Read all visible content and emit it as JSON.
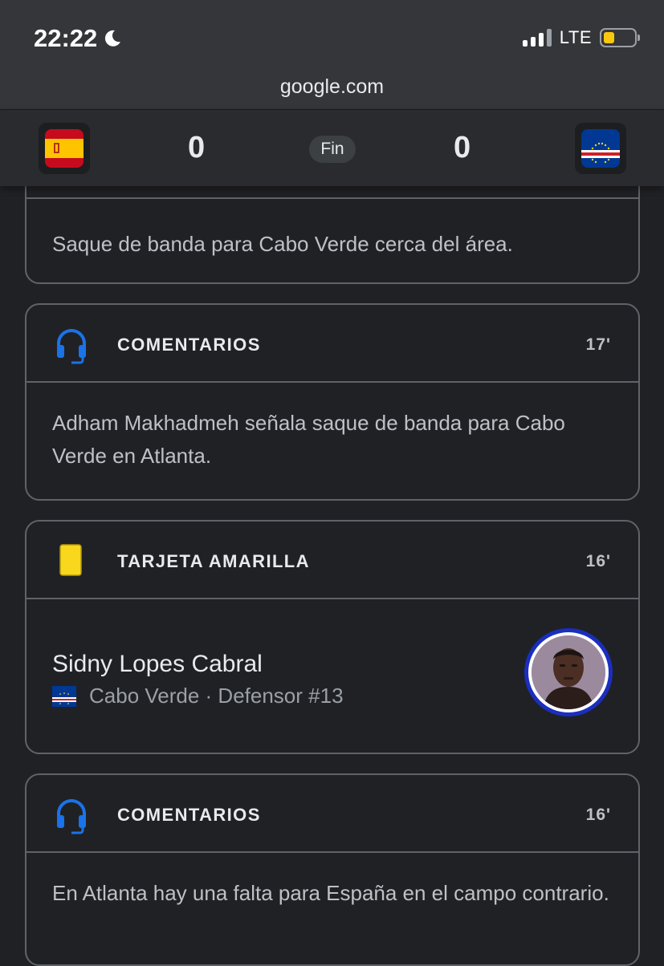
{
  "status_bar": {
    "time": "22:22",
    "network": "LTE",
    "moon_icon": "moon-icon",
    "battery_color": "#f9c80e"
  },
  "browser": {
    "url": "google.com"
  },
  "match": {
    "home_flag": "spain-flag-icon",
    "home_score": "0",
    "status": "Fin",
    "away_score": "0",
    "away_flag": "cape-verde-flag-icon"
  },
  "events": {
    "e0": {
      "text": "Saque de banda para Cabo Verde cerca del área."
    },
    "e1": {
      "icon": "headset-icon",
      "title": "COMENTARIOS",
      "minute": "17'",
      "text": "Adham Makhadmeh señala saque de banda para Cabo Verde en Atlanta."
    },
    "e2": {
      "icon": "yellow-card-icon",
      "title": "TARJETA AMARILLA",
      "minute": "16'",
      "player": "Sidny Lopes Cabral",
      "meta": "Cabo Verde · Defensor #13"
    },
    "e3": {
      "icon": "headset-icon",
      "title": "COMENTARIOS",
      "minute": "16'",
      "text": "En Atlanta hay una falta para España en el campo contrario."
    }
  },
  "colors": {
    "background": "#202124",
    "card_border": "#5f6368",
    "accent_blue": "#1a73e8",
    "yellow_card": "#f9d71c"
  }
}
